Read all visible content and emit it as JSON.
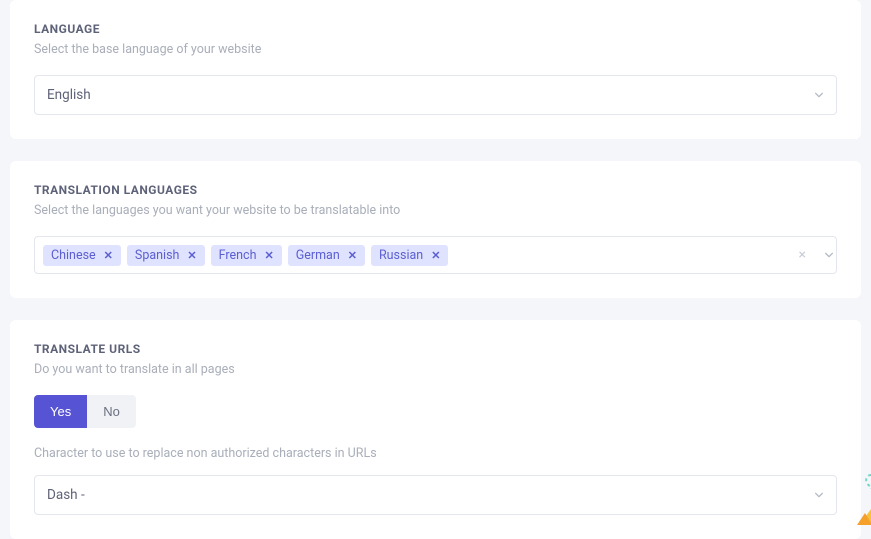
{
  "language": {
    "title": "LANGUAGE",
    "description": "Select the base language of your website",
    "selected": "English"
  },
  "translation": {
    "title": "TRANSLATION LANGUAGES",
    "description": "Select the languages you want your website to be translatable into",
    "tags": [
      "Chinese",
      "Spanish",
      "French",
      "German",
      "Russian"
    ]
  },
  "translateUrls": {
    "title": "TRANSLATE URLS",
    "description": "Do you want to translate in all pages",
    "yes": "Yes",
    "no": "No",
    "charDesc": "Character to use to replace non authorized characters in URLs",
    "charSelected": "Dash -"
  }
}
